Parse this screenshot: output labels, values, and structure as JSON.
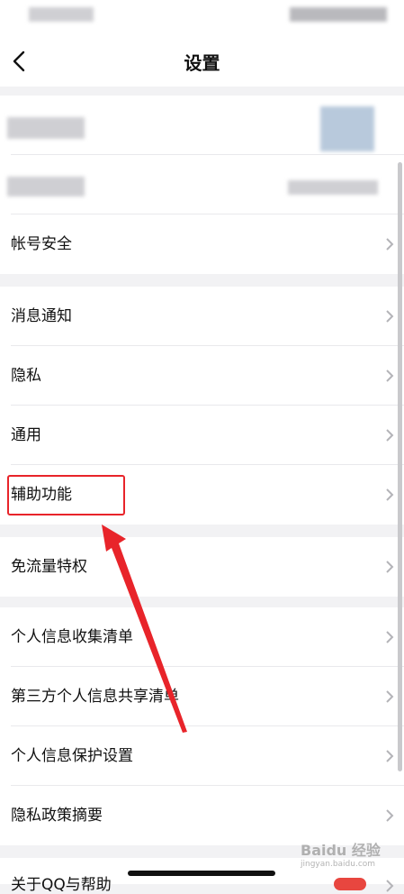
{
  "nav": {
    "title": "设置"
  },
  "account_rows": [
    {
      "label": "帐号安全"
    }
  ],
  "group2": [
    {
      "label": "消息通知"
    },
    {
      "label": "隐私"
    },
    {
      "label": "通用"
    },
    {
      "label": "辅助功能"
    }
  ],
  "group3": [
    {
      "label": "免流量特权"
    }
  ],
  "group4": [
    {
      "label": "个人信息收集清单"
    },
    {
      "label": "第三方个人信息共享清单"
    },
    {
      "label": "个人信息保护设置"
    },
    {
      "label": "隐私政策摘要"
    }
  ],
  "bottom_row": {
    "label": "关于QQ与帮助"
  },
  "watermark": {
    "text": "Baidu 经验",
    "sub": "jingyan.baidu.com"
  },
  "colors": {
    "highlight": "#e8242a",
    "arrow": "#e8242a"
  }
}
